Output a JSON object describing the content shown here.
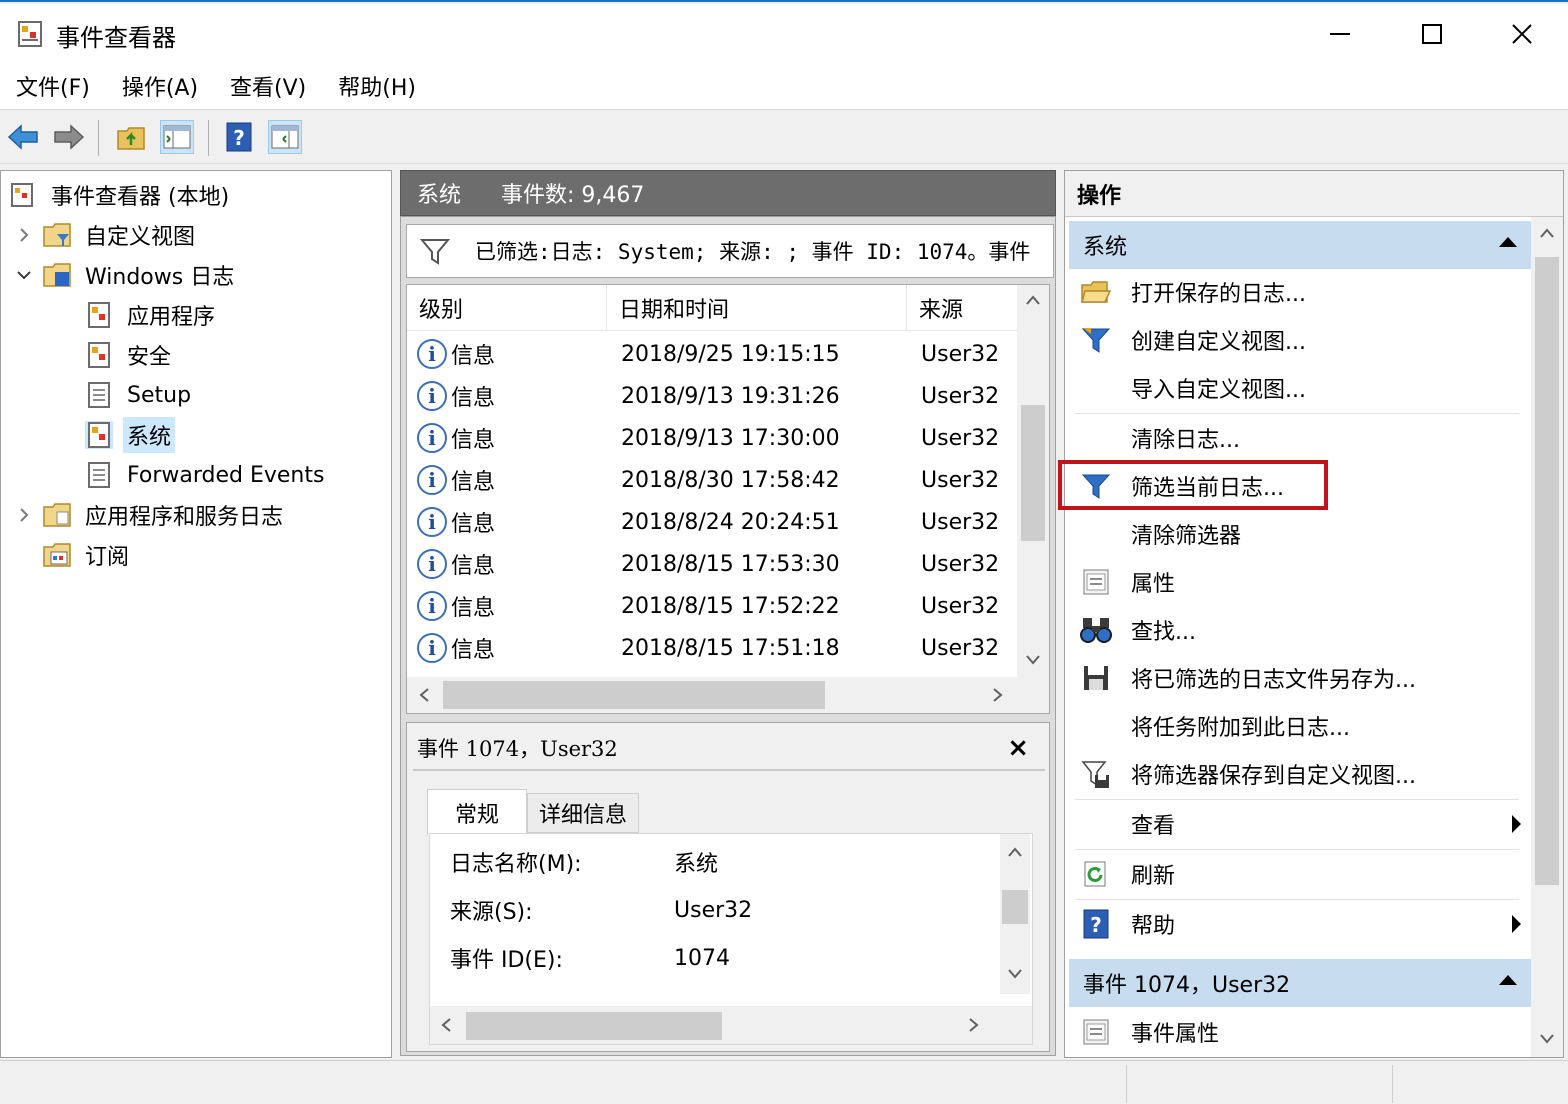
{
  "window": {
    "title": "事件查看器"
  },
  "menu": [
    "文件(F)",
    "操作(A)",
    "查看(V)",
    "帮助(H)"
  ],
  "toolbar": {
    "icons": [
      "back-icon",
      "forward-icon",
      "up-folder-icon",
      "show-hide-tree-icon",
      "help-icon",
      "show-hide-action-pane-icon"
    ]
  },
  "tree": {
    "root": "事件查看器 (本地)",
    "custom_views": "自定义视图",
    "windows_logs": "Windows 日志",
    "application": "应用程序",
    "security": "安全",
    "setup": "Setup",
    "system": "系统",
    "forwarded": "Forwarded Events",
    "app_service_logs": "应用程序和服务日志",
    "subscriptions": "订阅"
  },
  "center": {
    "log_name": "系统",
    "event_count": "事件数: 9,467",
    "filter_text": "已筛选:日志: System; 来源: ; 事件 ID: 1074。事件",
    "columns": [
      "级别",
      "日期和时间",
      "来源"
    ],
    "rows": [
      {
        "level": "信息",
        "datetime": "2018/9/25 19:15:15",
        "source": "User32"
      },
      {
        "level": "信息",
        "datetime": "2018/9/13 19:31:26",
        "source": "User32"
      },
      {
        "level": "信息",
        "datetime": "2018/9/13 17:30:00",
        "source": "User32"
      },
      {
        "level": "信息",
        "datetime": "2018/8/30 17:58:42",
        "source": "User32"
      },
      {
        "level": "信息",
        "datetime": "2018/8/24 20:24:51",
        "source": "User32"
      },
      {
        "level": "信息",
        "datetime": "2018/8/15 17:53:30",
        "source": "User32"
      },
      {
        "level": "信息",
        "datetime": "2018/8/15 17:52:22",
        "source": "User32"
      },
      {
        "level": "信息",
        "datetime": "2018/8/15 17:51:18",
        "source": "User32"
      }
    ],
    "info_glyph": "i"
  },
  "detail": {
    "title": "事件 1074，User32",
    "close": "×",
    "tabs": [
      "常规",
      "详细信息"
    ],
    "props": [
      {
        "label": "日志名称(M):",
        "value": "系统"
      },
      {
        "label": "来源(S):",
        "value": "User32"
      },
      {
        "label": "事件 ID(E):",
        "value": "1074"
      }
    ]
  },
  "actions": {
    "title": "操作",
    "section1": "系统",
    "items1": [
      {
        "label": "打开保存的日志...",
        "icon": "open-folder-icon"
      },
      {
        "label": "创建自定义视图...",
        "icon": "filter-create-icon"
      },
      {
        "label": "导入自定义视图...",
        "icon": ""
      },
      {
        "label": "清除日志...",
        "icon": ""
      },
      {
        "label": "筛选当前日志...",
        "icon": "filter-icon"
      },
      {
        "label": "清除筛选器",
        "icon": ""
      },
      {
        "label": "属性",
        "icon": "properties-icon"
      },
      {
        "label": "查找...",
        "icon": "binoculars-icon"
      },
      {
        "label": "将已筛选的日志文件另存为...",
        "icon": "save-icon"
      },
      {
        "label": "将任务附加到此日志...",
        "icon": ""
      },
      {
        "label": "将筛选器保存到自定义视图...",
        "icon": "filter-save-icon"
      },
      {
        "label": "查看",
        "icon": ""
      },
      {
        "label": "刷新",
        "icon": "refresh-icon"
      },
      {
        "label": "帮助",
        "icon": "help-icon"
      }
    ],
    "section2": "事件 1074，User32",
    "items2": [
      {
        "label": "事件属性",
        "icon": "properties-icon"
      }
    ]
  },
  "colors": {
    "highlight_border": "#c0131a",
    "section_bg": "#c8dcf0",
    "center_header_bg": "#6d6d6d"
  }
}
